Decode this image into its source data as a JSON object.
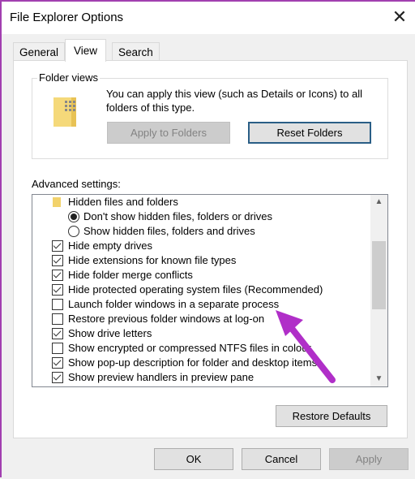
{
  "window": {
    "title": "File Explorer Options",
    "close_icon": "close-icon"
  },
  "tabs": [
    {
      "label": "General"
    },
    {
      "label": "View",
      "active": true
    },
    {
      "label": "Search"
    }
  ],
  "folder_views": {
    "label": "Folder views",
    "description": "You can apply this view (such as Details or Icons) to all folders of this type.",
    "apply_label": "Apply to Folders",
    "reset_label": "Reset Folders"
  },
  "advanced": {
    "label": "Advanced settings:",
    "items": [
      {
        "type": "folder",
        "label": "Hidden files and folders"
      },
      {
        "type": "radio",
        "label": "Don't show hidden files, folders or drives",
        "checked": true
      },
      {
        "type": "radio",
        "label": "Show hidden files, folders and drives",
        "checked": false
      },
      {
        "type": "checkbox",
        "label": "Hide empty drives",
        "checked": true
      },
      {
        "type": "checkbox",
        "label": "Hide extensions for known file types",
        "checked": true
      },
      {
        "type": "checkbox",
        "label": "Hide folder merge conflicts",
        "checked": true
      },
      {
        "type": "checkbox",
        "label": "Hide protected operating system files (Recommended)",
        "checked": true
      },
      {
        "type": "checkbox",
        "label": "Launch folder windows in a separate process",
        "checked": false
      },
      {
        "type": "checkbox",
        "label": "Restore previous folder windows at log-on",
        "checked": false
      },
      {
        "type": "checkbox",
        "label": "Show drive letters",
        "checked": true
      },
      {
        "type": "checkbox",
        "label": "Show encrypted or compressed NTFS files in colour",
        "checked": false
      },
      {
        "type": "checkbox",
        "label": "Show pop-up description for folder and desktop items",
        "checked": true
      },
      {
        "type": "checkbox",
        "label": "Show preview handlers in preview pane",
        "checked": true
      }
    ],
    "restore_label": "Restore Defaults"
  },
  "footer": {
    "ok": "OK",
    "cancel": "Cancel",
    "apply": "Apply"
  },
  "annotation": {
    "arrow_color": "#b02fc8"
  }
}
